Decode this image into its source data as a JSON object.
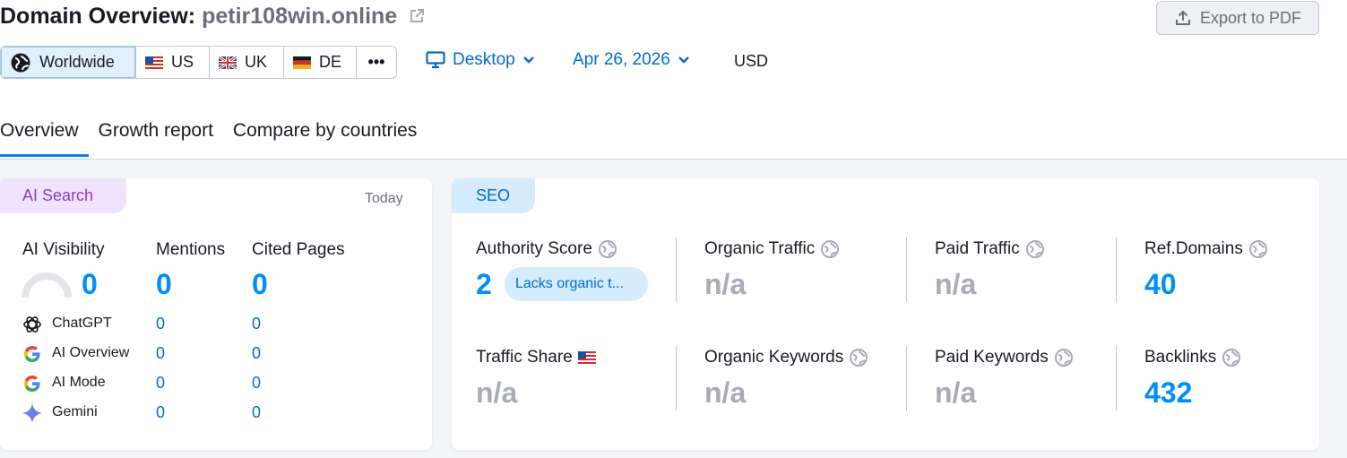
{
  "page": {
    "title_prefix": "Domain Overview:",
    "domain": "petir108win.online",
    "export_label": "Export to PDF"
  },
  "regions": [
    {
      "label": "Worldwide",
      "active": true
    },
    {
      "label": "US"
    },
    {
      "label": "UK"
    },
    {
      "label": "DE"
    },
    {
      "label": "•••"
    }
  ],
  "filters": {
    "device": "Desktop",
    "date": "Apr 26, 2026",
    "currency": "USD"
  },
  "tabs": [
    "Overview",
    "Growth report",
    "Compare by countries"
  ],
  "ai_card": {
    "badge": "AI Search",
    "date_label": "Today",
    "columns": {
      "visibility": {
        "label": "AI Visibility",
        "value": "0"
      },
      "mentions": {
        "label": "Mentions",
        "value": "0"
      },
      "cited": {
        "label": "Cited Pages",
        "value": "0"
      }
    },
    "rows": [
      {
        "name": "ChatGPT",
        "icon": "chatgpt-icon",
        "mentions": "0",
        "cited": "0"
      },
      {
        "name": "AI Overview",
        "icon": "google-icon",
        "mentions": "0",
        "cited": "0"
      },
      {
        "name": "AI Mode",
        "icon": "google-icon",
        "mentions": "0",
        "cited": "0"
      },
      {
        "name": "Gemini",
        "icon": "gemini-icon",
        "mentions": "0",
        "cited": "0"
      }
    ]
  },
  "seo_card": {
    "badge": "SEO",
    "authority": {
      "label": "Authority Score",
      "value": "2",
      "pill": "Lacks organic t..."
    },
    "organic_traffic": {
      "label": "Organic Traffic",
      "value": "n/a"
    },
    "paid_traffic": {
      "label": "Paid Traffic",
      "value": "n/a"
    },
    "ref_domains": {
      "label": "Ref.Domains",
      "value": "40"
    },
    "traffic_share": {
      "label": "Traffic Share",
      "value": "n/a"
    },
    "organic_keywords": {
      "label": "Organic Keywords",
      "value": "n/a"
    },
    "paid_keywords": {
      "label": "Paid Keywords",
      "value": "n/a"
    },
    "backlinks": {
      "label": "Backlinks",
      "value": "432"
    }
  },
  "colors": {
    "accent": "#008ff8",
    "link": "#006dca",
    "ai_badge_bg": "#f2e3fd",
    "seo_badge_bg": "#d5ecfc",
    "muted_value": "#a9abb6"
  }
}
